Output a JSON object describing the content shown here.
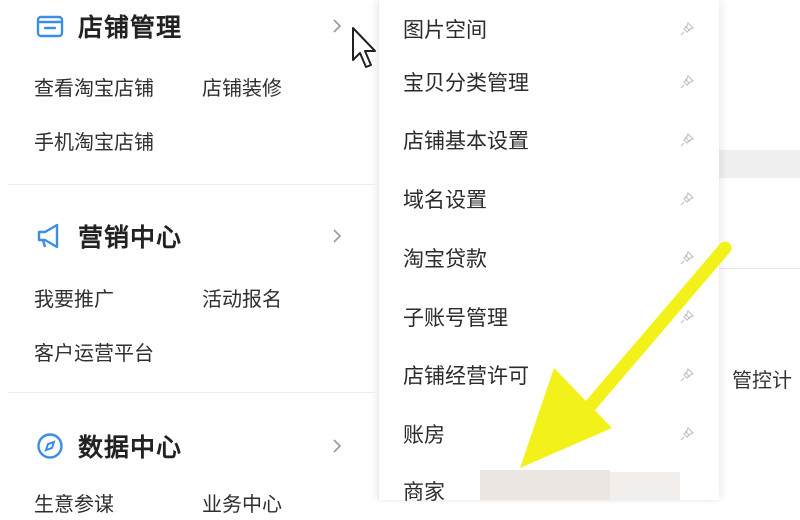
{
  "sidebar": {
    "sections": [
      {
        "title": "店铺管理",
        "icon": "store-icon",
        "links": [
          "查看淘宝店铺",
          "店铺装修",
          "手机淘宝店铺"
        ]
      },
      {
        "title": "营销中心",
        "icon": "megaphone-icon",
        "links": [
          "我要推广",
          "活动报名",
          "客户运营平台"
        ]
      },
      {
        "title": "数据中心",
        "icon": "compass-icon",
        "links": [
          "生意参谋",
          "业务中心"
        ]
      }
    ]
  },
  "flyout": {
    "items": [
      "图片空间",
      "宝贝分类管理",
      "店铺基本设置",
      "域名设置",
      "淘宝贷款",
      "子账号管理",
      "店铺经营许可",
      "账房",
      "商家"
    ]
  },
  "background": {
    "partial_text": "管控计"
  },
  "colors": {
    "icon_blue": "#3a8ee6",
    "arrow_yellow": "#f2f21a"
  }
}
